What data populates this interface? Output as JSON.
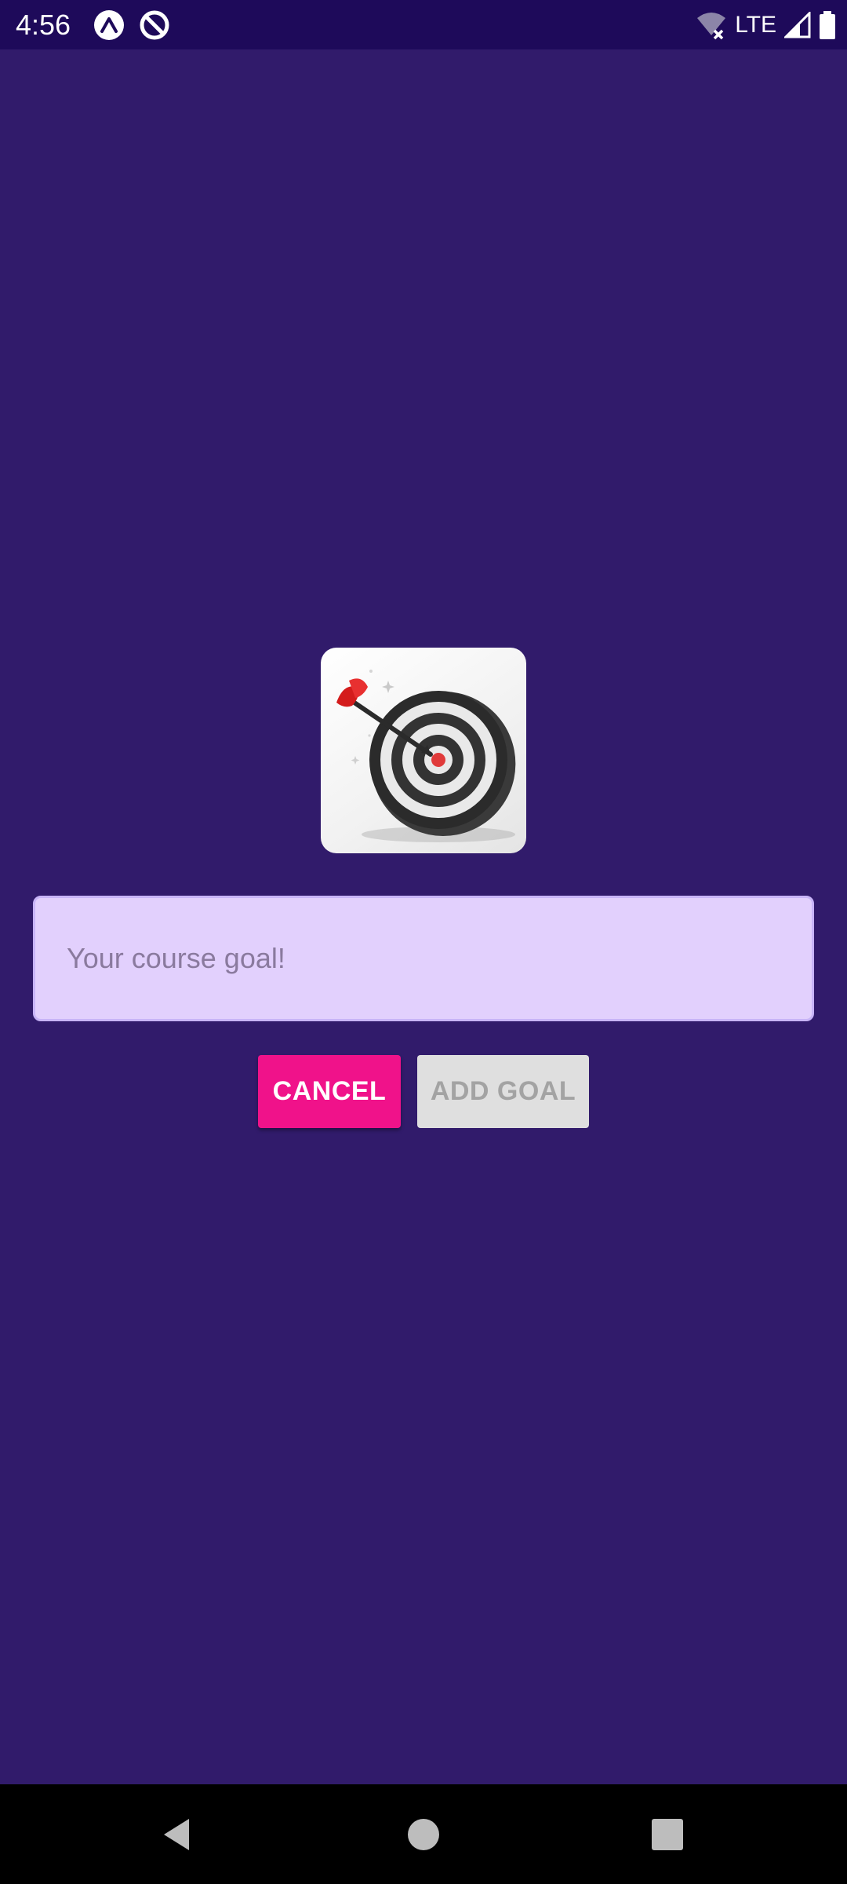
{
  "status_bar": {
    "time": "4:56",
    "network_label": "LTE",
    "icons": [
      "expo-notification-icon",
      "app-notification-icon",
      "wifi-off-icon",
      "cell-signal-icon",
      "battery-icon"
    ]
  },
  "goal_screen": {
    "image": "goal-target-icon",
    "input": {
      "placeholder": "Your course goal!",
      "value": ""
    },
    "buttons": {
      "cancel_label": "CANCEL",
      "add_label": "ADD GOAL"
    }
  },
  "nav_bar": {
    "icons": [
      "back-icon",
      "home-icon",
      "recents-icon"
    ]
  },
  "colors": {
    "background": "#311b6b",
    "status_bar": "#1e0a5a",
    "input_background": "#e2d0fd",
    "cancel_button": "#f0128a",
    "add_button_disabled": "#dfdfdf"
  }
}
